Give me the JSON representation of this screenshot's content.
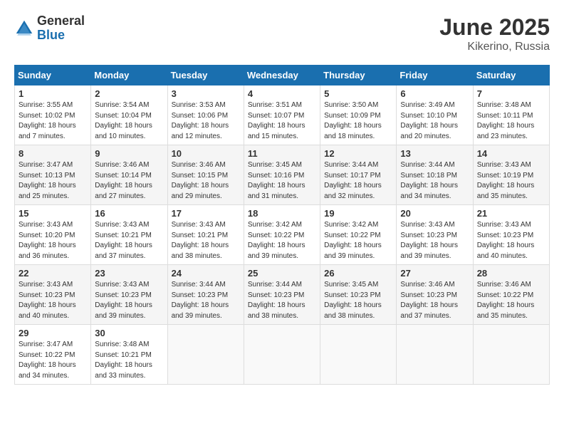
{
  "header": {
    "logo_general": "General",
    "logo_blue": "Blue",
    "month": "June 2025",
    "location": "Kikerino, Russia"
  },
  "weekdays": [
    "Sunday",
    "Monday",
    "Tuesday",
    "Wednesday",
    "Thursday",
    "Friday",
    "Saturday"
  ],
  "weeks": [
    [
      {
        "day": "1",
        "info": "Sunrise: 3:55 AM\nSunset: 10:02 PM\nDaylight: 18 hours\nand 7 minutes."
      },
      {
        "day": "2",
        "info": "Sunrise: 3:54 AM\nSunset: 10:04 PM\nDaylight: 18 hours\nand 10 minutes."
      },
      {
        "day": "3",
        "info": "Sunrise: 3:53 AM\nSunset: 10:06 PM\nDaylight: 18 hours\nand 12 minutes."
      },
      {
        "day": "4",
        "info": "Sunrise: 3:51 AM\nSunset: 10:07 PM\nDaylight: 18 hours\nand 15 minutes."
      },
      {
        "day": "5",
        "info": "Sunrise: 3:50 AM\nSunset: 10:09 PM\nDaylight: 18 hours\nand 18 minutes."
      },
      {
        "day": "6",
        "info": "Sunrise: 3:49 AM\nSunset: 10:10 PM\nDaylight: 18 hours\nand 20 minutes."
      },
      {
        "day": "7",
        "info": "Sunrise: 3:48 AM\nSunset: 10:11 PM\nDaylight: 18 hours\nand 23 minutes."
      }
    ],
    [
      {
        "day": "8",
        "info": "Sunrise: 3:47 AM\nSunset: 10:13 PM\nDaylight: 18 hours\nand 25 minutes."
      },
      {
        "day": "9",
        "info": "Sunrise: 3:46 AM\nSunset: 10:14 PM\nDaylight: 18 hours\nand 27 minutes."
      },
      {
        "day": "10",
        "info": "Sunrise: 3:46 AM\nSunset: 10:15 PM\nDaylight: 18 hours\nand 29 minutes."
      },
      {
        "day": "11",
        "info": "Sunrise: 3:45 AM\nSunset: 10:16 PM\nDaylight: 18 hours\nand 31 minutes."
      },
      {
        "day": "12",
        "info": "Sunrise: 3:44 AM\nSunset: 10:17 PM\nDaylight: 18 hours\nand 32 minutes."
      },
      {
        "day": "13",
        "info": "Sunrise: 3:44 AM\nSunset: 10:18 PM\nDaylight: 18 hours\nand 34 minutes."
      },
      {
        "day": "14",
        "info": "Sunrise: 3:43 AM\nSunset: 10:19 PM\nDaylight: 18 hours\nand 35 minutes."
      }
    ],
    [
      {
        "day": "15",
        "info": "Sunrise: 3:43 AM\nSunset: 10:20 PM\nDaylight: 18 hours\nand 36 minutes."
      },
      {
        "day": "16",
        "info": "Sunrise: 3:43 AM\nSunset: 10:21 PM\nDaylight: 18 hours\nand 37 minutes."
      },
      {
        "day": "17",
        "info": "Sunrise: 3:43 AM\nSunset: 10:21 PM\nDaylight: 18 hours\nand 38 minutes."
      },
      {
        "day": "18",
        "info": "Sunrise: 3:42 AM\nSunset: 10:22 PM\nDaylight: 18 hours\nand 39 minutes."
      },
      {
        "day": "19",
        "info": "Sunrise: 3:42 AM\nSunset: 10:22 PM\nDaylight: 18 hours\nand 39 minutes."
      },
      {
        "day": "20",
        "info": "Sunrise: 3:43 AM\nSunset: 10:23 PM\nDaylight: 18 hours\nand 39 minutes."
      },
      {
        "day": "21",
        "info": "Sunrise: 3:43 AM\nSunset: 10:23 PM\nDaylight: 18 hours\nand 40 minutes."
      }
    ],
    [
      {
        "day": "22",
        "info": "Sunrise: 3:43 AM\nSunset: 10:23 PM\nDaylight: 18 hours\nand 40 minutes."
      },
      {
        "day": "23",
        "info": "Sunrise: 3:43 AM\nSunset: 10:23 PM\nDaylight: 18 hours\nand 39 minutes."
      },
      {
        "day": "24",
        "info": "Sunrise: 3:44 AM\nSunset: 10:23 PM\nDaylight: 18 hours\nand 39 minutes."
      },
      {
        "day": "25",
        "info": "Sunrise: 3:44 AM\nSunset: 10:23 PM\nDaylight: 18 hours\nand 38 minutes."
      },
      {
        "day": "26",
        "info": "Sunrise: 3:45 AM\nSunset: 10:23 PM\nDaylight: 18 hours\nand 38 minutes."
      },
      {
        "day": "27",
        "info": "Sunrise: 3:46 AM\nSunset: 10:23 PM\nDaylight: 18 hours\nand 37 minutes."
      },
      {
        "day": "28",
        "info": "Sunrise: 3:46 AM\nSunset: 10:22 PM\nDaylight: 18 hours\nand 35 minutes."
      }
    ],
    [
      {
        "day": "29",
        "info": "Sunrise: 3:47 AM\nSunset: 10:22 PM\nDaylight: 18 hours\nand 34 minutes."
      },
      {
        "day": "30",
        "info": "Sunrise: 3:48 AM\nSunset: 10:21 PM\nDaylight: 18 hours\nand 33 minutes."
      },
      null,
      null,
      null,
      null,
      null
    ]
  ]
}
